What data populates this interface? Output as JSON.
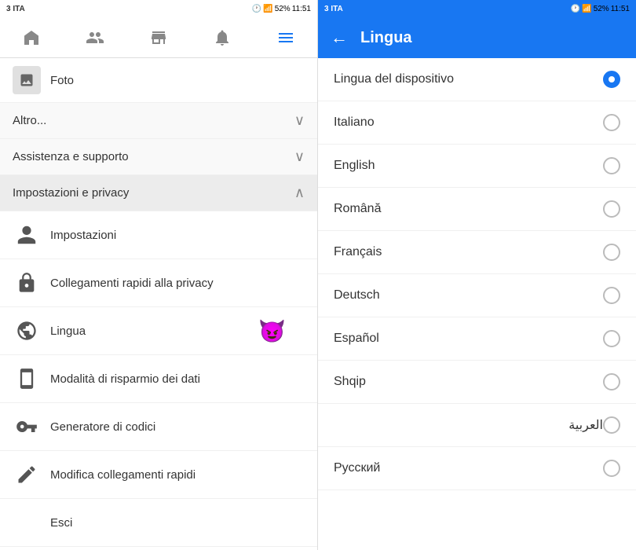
{
  "left": {
    "status_bar": {
      "carrier": "3 ITA",
      "time": "11:51",
      "battery": "52%"
    },
    "nav_items": [
      {
        "name": "home-nav",
        "label": "Home"
      },
      {
        "name": "friends-nav",
        "label": "Amici"
      },
      {
        "name": "marketplace-nav",
        "label": "Marketplace"
      },
      {
        "name": "notifications-nav",
        "label": "Notifiche"
      },
      {
        "name": "menu-nav",
        "label": "Menu"
      }
    ],
    "photo_label": "Foto",
    "sections": [
      {
        "name": "altro-section",
        "label": "Altro...",
        "expanded": false
      },
      {
        "name": "assistenza-section",
        "label": "Assistenza e supporto",
        "expanded": false
      },
      {
        "name": "impostazioni-section",
        "label": "Impostazioni e privacy",
        "expanded": true
      }
    ],
    "sub_items": [
      {
        "name": "impostazioni-item",
        "label": "Impostazioni",
        "icon": "person"
      },
      {
        "name": "collegamenti-item",
        "label": "Collegamenti rapidi alla privacy",
        "icon": "lock"
      },
      {
        "name": "lingua-item",
        "label": "Lingua",
        "icon": "globe",
        "has_devil": true
      },
      {
        "name": "risparmio-item",
        "label": "Modalità di risparmio dei dati",
        "icon": "phone"
      },
      {
        "name": "codici-item",
        "label": "Generatore di codici",
        "icon": "key"
      },
      {
        "name": "modifica-item",
        "label": "Modifica collegamenti rapidi",
        "icon": "pencil"
      },
      {
        "name": "esci-item",
        "label": "Esci",
        "icon": "none"
      }
    ]
  },
  "right": {
    "status_bar": {
      "carrier": "3 ITA",
      "time": "11:51",
      "battery": "52%"
    },
    "header": {
      "back_label": "←",
      "title": "Lingua"
    },
    "languages": [
      {
        "name": "device-lang",
        "label": "Lingua del dispositivo",
        "selected": true
      },
      {
        "name": "italiano",
        "label": "Italiano",
        "selected": false
      },
      {
        "name": "english",
        "label": "English",
        "selected": false
      },
      {
        "name": "romana",
        "label": "Română",
        "selected": false
      },
      {
        "name": "francais",
        "label": "Français",
        "selected": false
      },
      {
        "name": "deutsch",
        "label": "Deutsch",
        "selected": false
      },
      {
        "name": "espanol",
        "label": "Español",
        "selected": false
      },
      {
        "name": "shqip",
        "label": "Shqip",
        "selected": false
      },
      {
        "name": "arabic",
        "label": "العربية",
        "selected": false
      },
      {
        "name": "russian",
        "label": "Русский",
        "selected": false
      }
    ]
  }
}
